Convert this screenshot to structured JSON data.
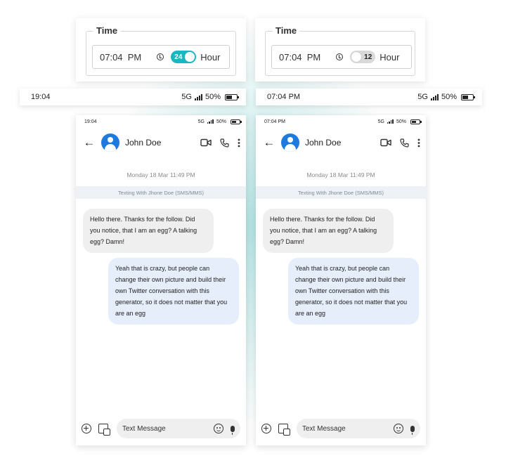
{
  "left": {
    "time_card": {
      "legend": "Time",
      "time_value": "07:04  PM",
      "toggle_label": "24",
      "toggle_state": "on",
      "unit_label": "Hour"
    },
    "status_bar": {
      "time": "19:04",
      "network": "5G",
      "battery": "50%"
    },
    "phone": {
      "status_time": "19:04",
      "status_network": "5G",
      "status_battery": "50%",
      "contact_name": "John Doe",
      "date_label": "Monday 18 Mar 11:49 PM",
      "texting_label": "Texting With Jhone Doe (SMS/MMS)",
      "incoming_message": "Hello there. Thanks for the follow. Did you notice, that I am an egg? A talking egg? Damn!",
      "outgoing_message": "Yeah that is crazy, but people can change their own picture and build their own Twitter conversation with this generator, so it does not matter that you are an egg",
      "composer_placeholder": "Text Message"
    }
  },
  "right": {
    "time_card": {
      "legend": "Time",
      "time_value": "07:04  PM",
      "toggle_label": "12",
      "toggle_state": "off",
      "unit_label": "Hour"
    },
    "status_bar": {
      "time": "07:04 PM",
      "network": "5G",
      "battery": "50%"
    },
    "phone": {
      "status_time": "07:04 PM",
      "status_network": "5G",
      "status_battery": "50%",
      "contact_name": "John Doe",
      "date_label": "Monday 18 Mar 11:49 PM",
      "texting_label": "Texting With Jhone Doe (SMS/MMS)",
      "incoming_message": "Hello there. Thanks for the follow. Did you notice, that I am an egg? A talking egg? Damn!",
      "outgoing_message": "Yeah that is crazy, but people can change their own picture and build their own Twitter conversation with this generator, so it does not matter that you are an egg",
      "composer_placeholder": "Text Message"
    }
  },
  "colors": {
    "accent": "#19b7c2",
    "avatar": "#1f7ae0",
    "incoming_bubble": "#efefef",
    "outgoing_bubble": "#e6eefb",
    "glow": "#78cdcd"
  },
  "icons": [
    "back-arrow-icon",
    "avatar-icon",
    "video-call-icon",
    "phone-call-icon",
    "more-vertical-icon",
    "clock-icon",
    "signal-icon",
    "battery-icon",
    "add-icon",
    "gallery-icon",
    "emoji-icon",
    "mic-icon"
  ]
}
